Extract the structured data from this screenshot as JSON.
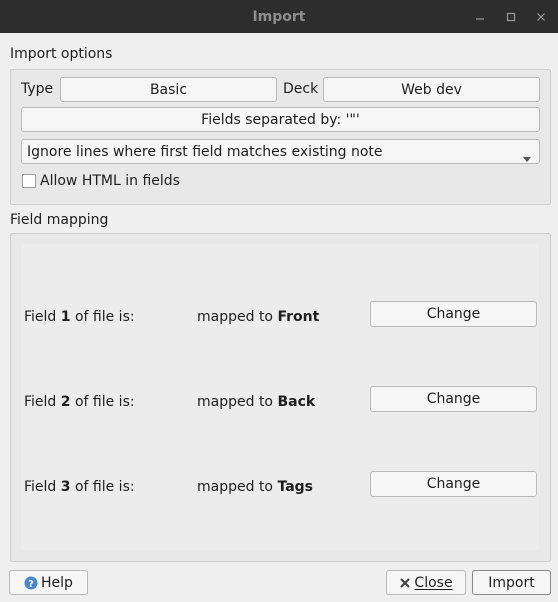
{
  "window": {
    "title": "Import"
  },
  "import_options": {
    "label": "Import options",
    "type_label": "Type",
    "type_value": "Basic",
    "deck_label": "Deck",
    "deck_value": "Web dev",
    "fields_separated_button": "Fields separated by: '\"'",
    "duplicate_mode": "Ignore lines where first field matches existing note",
    "allow_html_label": "Allow HTML in fields",
    "allow_html_checked": false
  },
  "field_mapping": {
    "label": "Field mapping",
    "rows": [
      {
        "prefix": "Field ",
        "num": "1",
        "suffix": " of file is:",
        "mapped_prefix": "mapped to ",
        "target": "Front",
        "button": "Change"
      },
      {
        "prefix": "Field ",
        "num": "2",
        "suffix": " of file is:",
        "mapped_prefix": "mapped to ",
        "target": "Back",
        "button": "Change"
      },
      {
        "prefix": "Field ",
        "num": "3",
        "suffix": " of file is:",
        "mapped_prefix": "mapped to ",
        "target": "Tags",
        "button": "Change"
      }
    ]
  },
  "footer": {
    "help_label": "Help",
    "close_label": "Close",
    "import_label": "Import"
  },
  "colors": {
    "titlebar": "#2d2d2d",
    "dialog_bg": "#efefef",
    "help_icon": "#4a86c8",
    "close_icon": "#444444"
  }
}
